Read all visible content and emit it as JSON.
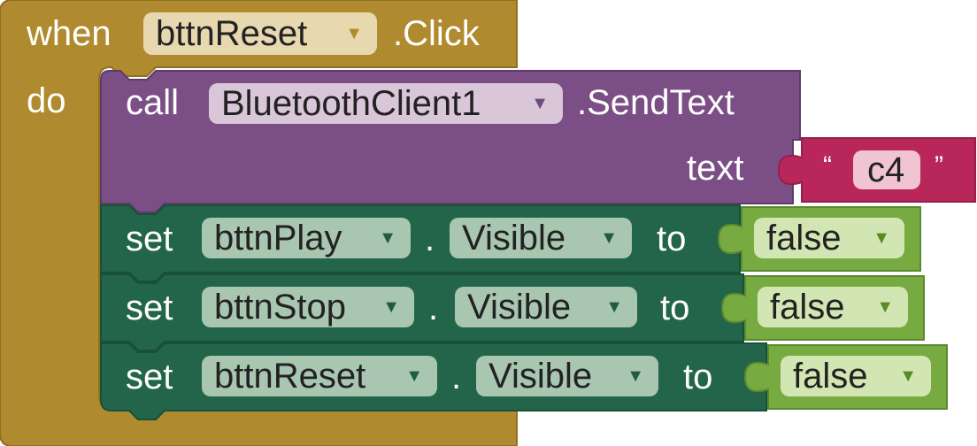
{
  "event_block": {
    "keyword_when": "when",
    "component": "bttnReset",
    "event": ".Click",
    "keyword_do": "do",
    "color": "#b08a2e"
  },
  "call_block": {
    "keyword_call": "call",
    "component": "BluetoothClient1",
    "method": ".SendText",
    "param_label": "text",
    "color": "#7b4f86"
  },
  "text_block": {
    "open_quote": "“",
    "value": "c4",
    "close_quote": "”",
    "color": "#b9275a"
  },
  "set_blocks": [
    {
      "keyword_set": "set",
      "component": "bttnPlay",
      "dot": ".",
      "property": "Visible",
      "keyword_to": "to",
      "value": "false"
    },
    {
      "keyword_set": "set",
      "component": "bttnStop",
      "dot": ".",
      "property": "Visible",
      "keyword_to": "to",
      "value": "false"
    },
    {
      "keyword_set": "set",
      "component": "bttnReset",
      "dot": ".",
      "property": "Visible",
      "keyword_to": "to",
      "value": "false"
    }
  ],
  "colors": {
    "set_block": "#23654a",
    "boolean_block": "#77ab41"
  },
  "icons": {
    "dropdown": "▼"
  }
}
